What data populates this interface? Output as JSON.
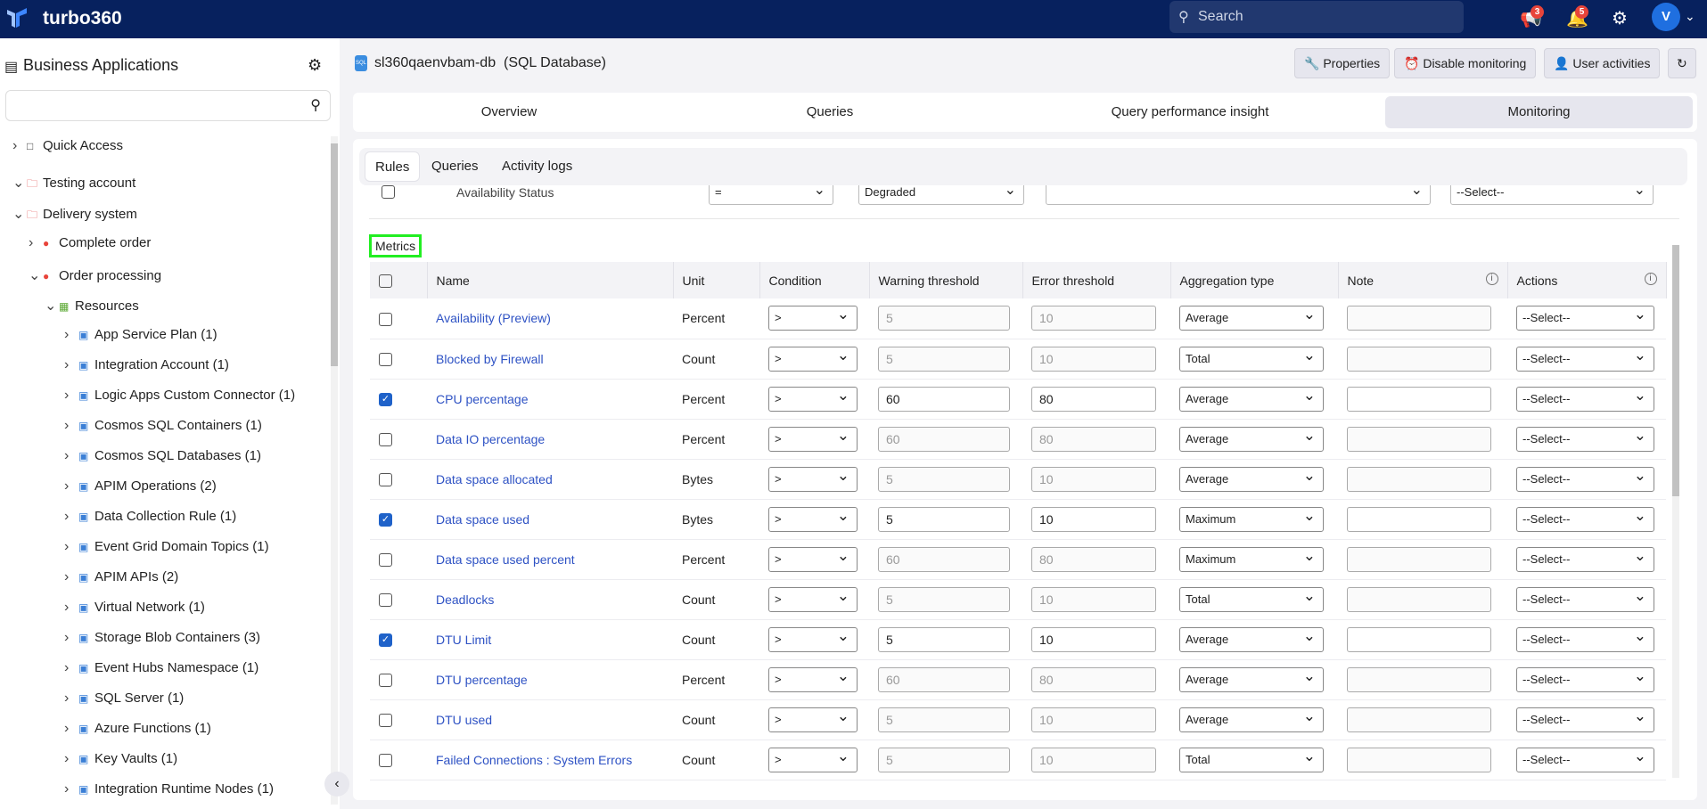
{
  "app": {
    "brand": "turbo360",
    "search_placeholder": "Search",
    "announcements_count": "3",
    "notifications_count": "5",
    "avatar_initial": "V"
  },
  "sidebar": {
    "title": "Business Applications",
    "search_value": "",
    "tree": [
      {
        "label": "Quick Access",
        "level": 0,
        "expanded": false,
        "icon": "bookmark-icon"
      },
      {
        "label": "Testing account",
        "level": 0,
        "expanded": true,
        "icon": "folder-icon"
      },
      {
        "label": "Delivery system",
        "level": 1,
        "expanded": true,
        "icon": "folder-icon"
      },
      {
        "label": "Complete order",
        "level": 2,
        "expanded": false,
        "icon": "red-dot-icon"
      },
      {
        "label": "Order processing",
        "level": 2,
        "expanded": true,
        "icon": "red-dot-icon"
      },
      {
        "label": "Resources",
        "level": 3,
        "expanded": true,
        "icon": "grid-icon"
      },
      {
        "label": "App Service Plan (1)",
        "level": 4,
        "icon": "app-service-plan-icon"
      },
      {
        "label": "Integration Account (1)",
        "level": 4,
        "icon": "integration-account-icon"
      },
      {
        "label": "Logic Apps Custom Connector (1)",
        "level": 4,
        "icon": "logic-apps-connector-icon"
      },
      {
        "label": "Cosmos SQL Containers (1)",
        "level": 4,
        "icon": "cosmos-icon"
      },
      {
        "label": "Cosmos SQL Databases (1)",
        "level": 4,
        "icon": "cosmos-icon"
      },
      {
        "label": "APIM Operations (2)",
        "level": 4,
        "icon": "apim-icon"
      },
      {
        "label": "Data Collection Rule (1)",
        "level": 4,
        "icon": "data-collection-icon"
      },
      {
        "label": "Event Grid Domain Topics (1)",
        "level": 4,
        "icon": "event-grid-icon"
      },
      {
        "label": "APIM APIs (2)",
        "level": 4,
        "icon": "apim-api-icon"
      },
      {
        "label": "Virtual Network (1)",
        "level": 4,
        "icon": "virtual-network-icon"
      },
      {
        "label": "Storage Blob Containers (3)",
        "level": 4,
        "icon": "storage-icon"
      },
      {
        "label": "Event Hubs Namespace (1)",
        "level": 4,
        "icon": "event-hubs-icon"
      },
      {
        "label": "SQL Server (1)",
        "level": 4,
        "icon": "sql-server-icon"
      },
      {
        "label": "Azure Functions (1)",
        "level": 4,
        "icon": "functions-icon"
      },
      {
        "label": "Key Vaults (1)",
        "level": 4,
        "icon": "key-vault-icon"
      },
      {
        "label": "Integration Runtime Nodes (1)",
        "level": 4,
        "icon": "runtime-nodes-icon"
      }
    ]
  },
  "resource": {
    "name": "sl360qaenvbam-db",
    "type": "(SQL Database)"
  },
  "toolbar": {
    "properties": "Properties",
    "disable_monitoring": "Disable monitoring",
    "user_activities": "User activities"
  },
  "main_tabs": [
    {
      "label": "Overview"
    },
    {
      "label": "Queries"
    },
    {
      "label": "Query performance insight"
    },
    {
      "label": "Monitoring",
      "active": true
    }
  ],
  "sub_tabs": [
    {
      "label": "Rules",
      "active": true
    },
    {
      "label": "Queries"
    },
    {
      "label": "Activity logs"
    }
  ],
  "availability_row": {
    "name": "Availability Status",
    "condition": "=",
    "value": "Degraded",
    "note": "",
    "action": "--Select--"
  },
  "metrics": {
    "title": "Metrics",
    "columns": [
      "Name",
      "Unit",
      "Condition",
      "Warning threshold",
      "Error threshold",
      "Aggregation type",
      "Note",
      "Actions"
    ],
    "rows": [
      {
        "checked": false,
        "name": "Availability (Preview)",
        "unit": "Percent",
        "condition": ">",
        "warning": "5",
        "error": "10",
        "aggregation": "Average",
        "note": "",
        "action": "--Select--"
      },
      {
        "checked": false,
        "name": "Blocked by Firewall",
        "unit": "Count",
        "condition": ">",
        "warning": "5",
        "error": "10",
        "aggregation": "Total",
        "note": "",
        "action": "--Select--"
      },
      {
        "checked": true,
        "name": "CPU percentage",
        "unit": "Percent",
        "condition": ">",
        "warning": "60",
        "error": "80",
        "aggregation": "Average",
        "note": "",
        "action": "--Select--"
      },
      {
        "checked": false,
        "name": "Data IO percentage",
        "unit": "Percent",
        "condition": ">",
        "warning": "60",
        "error": "80",
        "aggregation": "Average",
        "note": "",
        "action": "--Select--"
      },
      {
        "checked": false,
        "name": "Data space allocated",
        "unit": "Bytes",
        "condition": ">",
        "warning": "5",
        "error": "10",
        "aggregation": "Average",
        "note": "",
        "action": "--Select--"
      },
      {
        "checked": true,
        "name": "Data space used",
        "unit": "Bytes",
        "condition": ">",
        "warning": "5",
        "error": "10",
        "aggregation": "Maximum",
        "note": "",
        "action": "--Select--"
      },
      {
        "checked": false,
        "name": "Data space used percent",
        "unit": "Percent",
        "condition": ">",
        "warning": "60",
        "error": "80",
        "aggregation": "Maximum",
        "note": "",
        "action": "--Select--"
      },
      {
        "checked": false,
        "name": "Deadlocks",
        "unit": "Count",
        "condition": ">",
        "warning": "5",
        "error": "10",
        "aggregation": "Total",
        "note": "",
        "action": "--Select--"
      },
      {
        "checked": true,
        "name": "DTU Limit",
        "unit": "Count",
        "condition": ">",
        "warning": "5",
        "error": "10",
        "aggregation": "Average",
        "note": "",
        "action": "--Select--"
      },
      {
        "checked": false,
        "name": "DTU percentage",
        "unit": "Percent",
        "condition": ">",
        "warning": "60",
        "error": "80",
        "aggregation": "Average",
        "note": "",
        "action": "--Select--"
      },
      {
        "checked": false,
        "name": "DTU used",
        "unit": "Count",
        "condition": ">",
        "warning": "5",
        "error": "10",
        "aggregation": "Average",
        "note": "",
        "action": "--Select--"
      },
      {
        "checked": false,
        "name": "Failed Connections : System Errors",
        "unit": "Count",
        "condition": ">",
        "warning": "5",
        "error": "10",
        "aggregation": "Total",
        "note": "",
        "action": "--Select--"
      }
    ]
  },
  "colors": {
    "topbar": "#07215e",
    "accent": "#1f62c9",
    "link": "#2e52c4",
    "badge": "#e8443a",
    "highlight": "#22ee22"
  }
}
